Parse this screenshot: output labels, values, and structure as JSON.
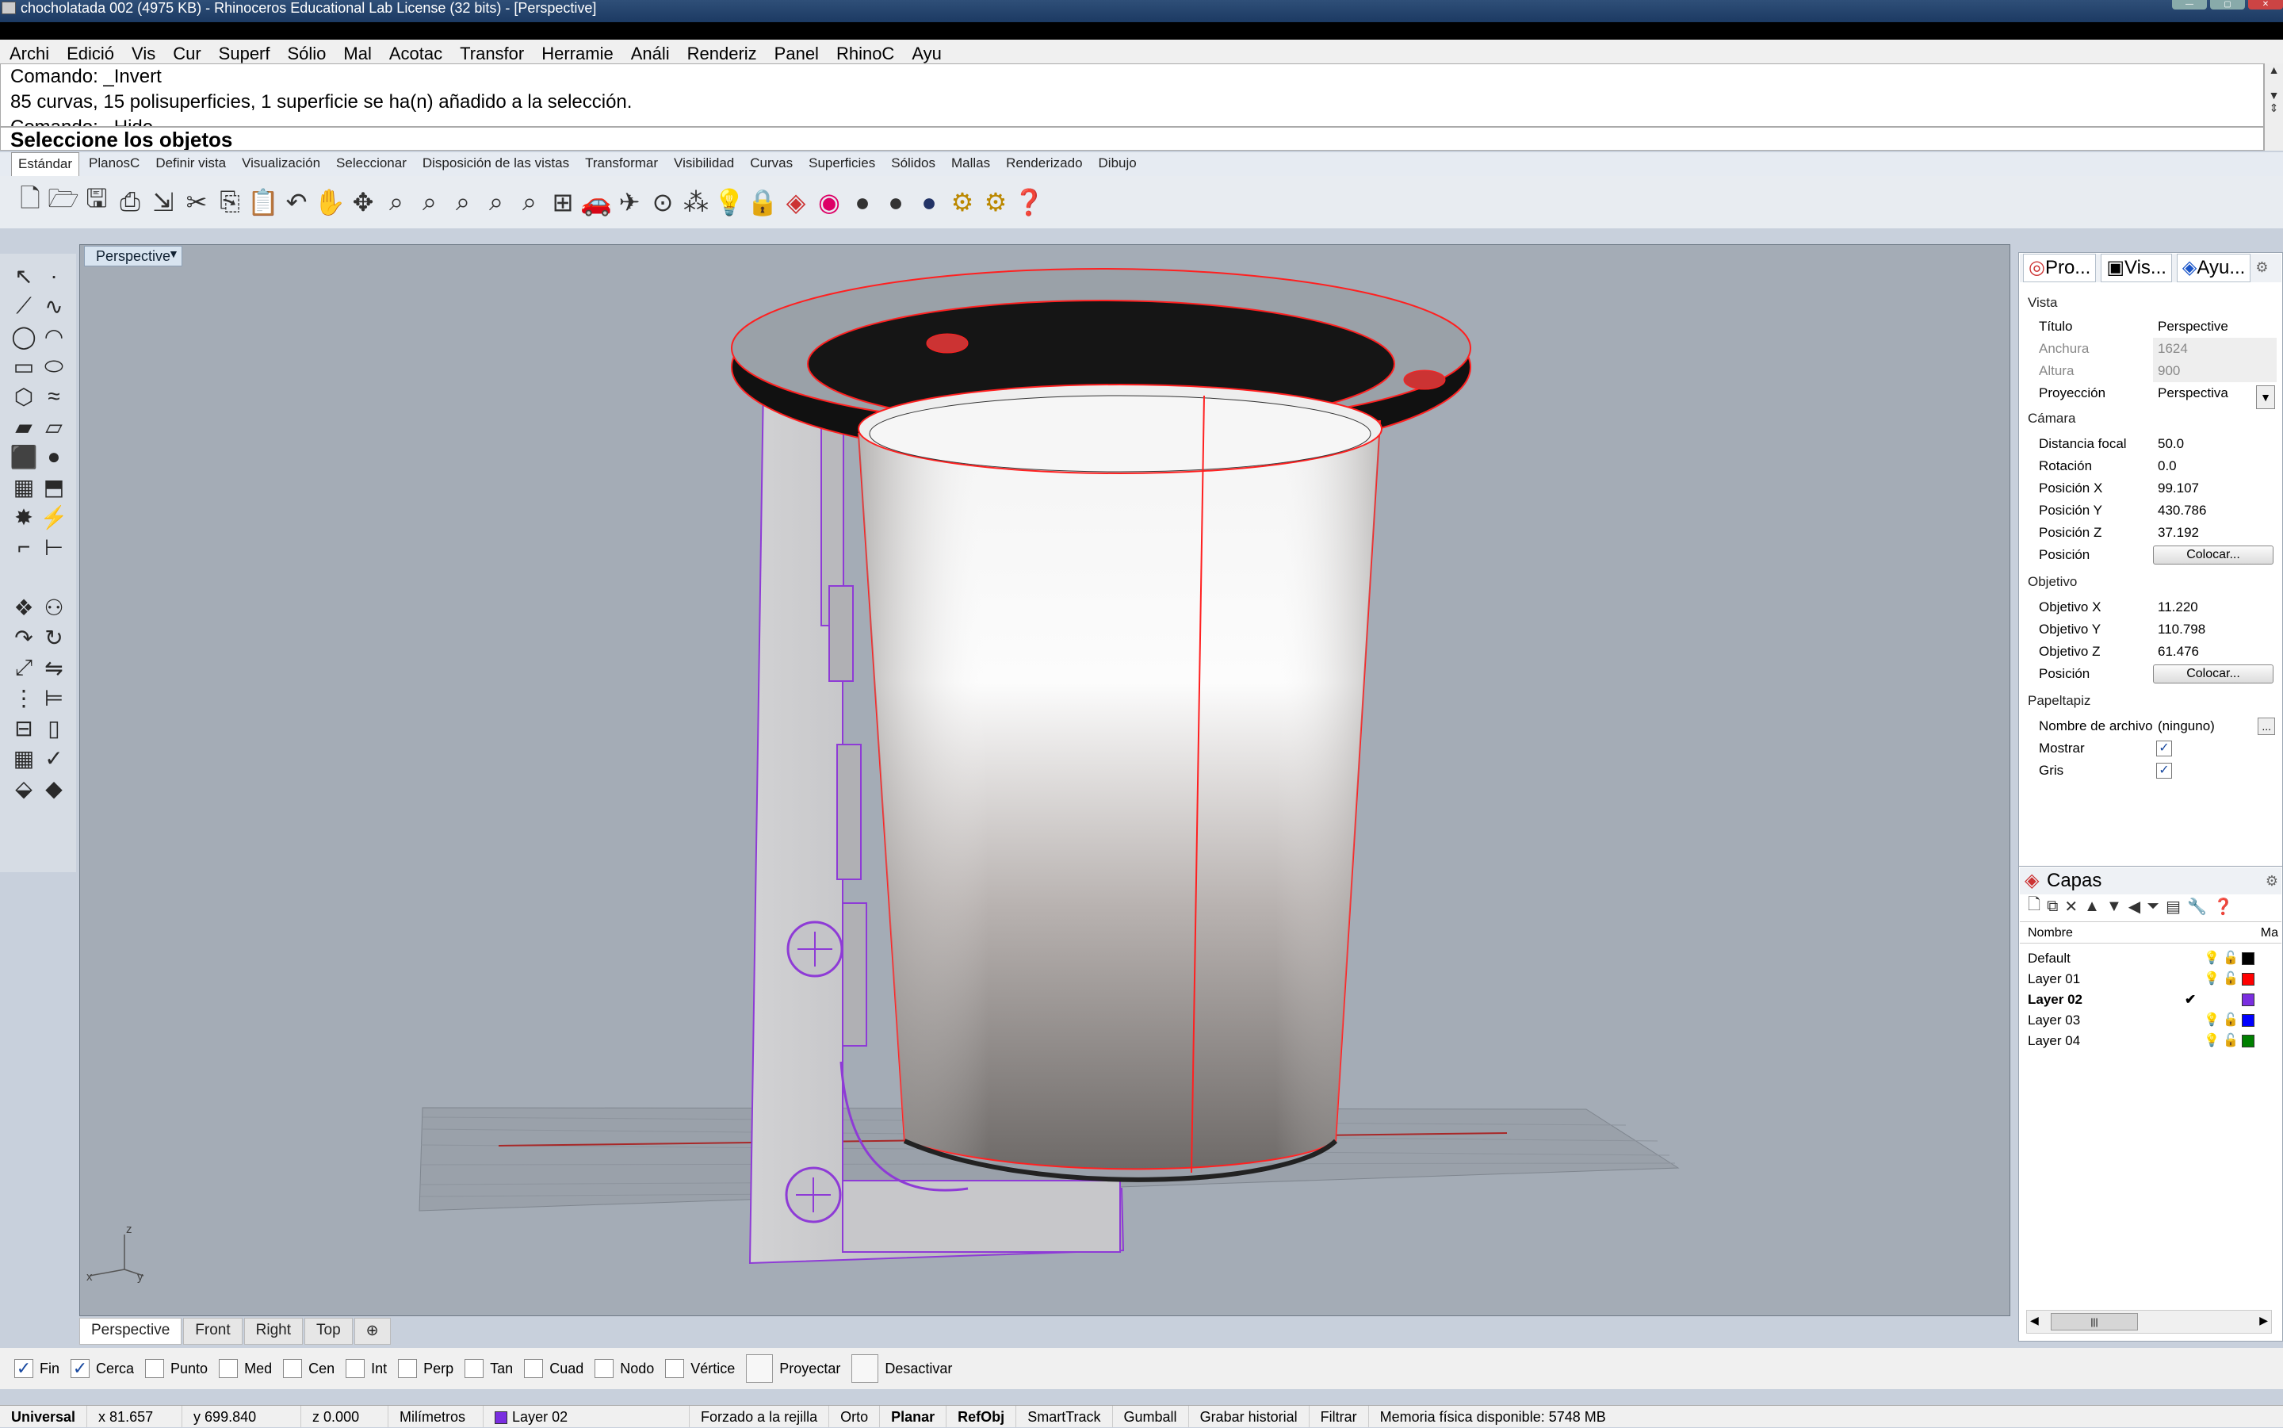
{
  "window": {
    "title": "chocholatada 002 (4975 KB) - Rhinoceros Educational Lab License (32 bits) - [Perspective]"
  },
  "menu": [
    "Archi",
    "Edició",
    "Vis",
    "Cur",
    "Superf",
    "Sólio",
    "Mal",
    "Acotac",
    "Transfor",
    "Herramie",
    "Análi",
    "Renderiz",
    "Panel",
    "RhinoC",
    "Ayu"
  ],
  "command": {
    "history_1": "Comando: _Invert",
    "history_2": "85 curvas, 15 polisuperficies, 1 superficie se ha(n) añadido a la selección.",
    "history_3": "Comando: _Hide",
    "prompt": "Seleccione los objetos"
  },
  "toolbar_tabs": [
    "Estándar",
    "PlanosC",
    "Definir vista",
    "Visualización",
    "Seleccionar",
    "Disposición de las vistas",
    "Transformar",
    "Visibilidad",
    "Curvas",
    "Superficies",
    "Sólidos",
    "Mallas",
    "Renderizado",
    "Dibujo"
  ],
  "viewport": {
    "title": "Perspective",
    "axis_z": "z",
    "axis_x": "x",
    "axis_y": "y"
  },
  "view_tabs": [
    "Perspective",
    "Front",
    "Right",
    "Top"
  ],
  "panel_tabs": [
    "Pro...",
    "Vis...",
    "Ayu..."
  ],
  "properties": {
    "vista_section": "Vista",
    "titulo_label": "Título",
    "titulo_value": "Perspective",
    "anchura_label": "Anchura",
    "anchura_value": "1624",
    "altura_label": "Altura",
    "altura_value": "900",
    "proyeccion_label": "Proyección",
    "proyeccion_value": "Perspectiva",
    "camara_section": "Cámara",
    "focal_label": "Distancia focal",
    "focal_value": "50.0",
    "rotacion_label": "Rotación",
    "rotacion_value": "0.0",
    "posx_label": "Posición X",
    "posx_value": "99.107",
    "posy_label": "Posición Y",
    "posy_value": "430.786",
    "posz_label": "Posición Z",
    "posz_value": "37.192",
    "posicion_label": "Posición",
    "colocar_label": "Colocar...",
    "objetivo_section": "Objetivo",
    "objx_label": "Objetivo X",
    "objx_value": "11.220",
    "objy_label": "Objetivo Y",
    "objy_value": "110.798",
    "objz_label": "Objetivo Z",
    "objz_value": "61.476",
    "posicion2_label": "Posición",
    "colocar2_label": "Colocar...",
    "papel_section": "Papeltapiz",
    "archivo_label": "Nombre de archivo",
    "archivo_value": "(ninguno)",
    "archivo_btn": "...",
    "mostrar_label": "Mostrar",
    "gris_label": "Gris"
  },
  "layers": {
    "title": "Capas",
    "col_name": "Nombre",
    "col_material": "Ma",
    "items": [
      {
        "name": "Default",
        "color": "#000000",
        "current": false
      },
      {
        "name": "Layer 01",
        "color": "#ff0000",
        "current": false
      },
      {
        "name": "Layer 02",
        "color": "#7a2ee0",
        "current": true
      },
      {
        "name": "Layer 03",
        "color": "#0000ff",
        "current": false
      },
      {
        "name": "Layer 04",
        "color": "#008000",
        "current": false
      }
    ],
    "current_mark": "✔"
  },
  "osnaps": [
    {
      "label": "Fin",
      "checked": true
    },
    {
      "label": "Cerca",
      "checked": true
    },
    {
      "label": "Punto",
      "checked": false
    },
    {
      "label": "Med",
      "checked": false
    },
    {
      "label": "Cen",
      "checked": false
    },
    {
      "label": "Int",
      "checked": false
    },
    {
      "label": "Perp",
      "checked": false
    },
    {
      "label": "Tan",
      "checked": false
    },
    {
      "label": "Cuad",
      "checked": false
    },
    {
      "label": "Nodo",
      "checked": false
    },
    {
      "label": "Vértice",
      "checked": false
    }
  ],
  "osnap_buttons": [
    "Proyectar",
    "Desactivar"
  ],
  "status": {
    "cplane": "Universal",
    "x": "x 81.657",
    "y": "y 699.840",
    "z": "z 0.000",
    "units": "Milímetros",
    "layer": "Layer 02",
    "layer_color": "#7a2ee0",
    "grid_snap": "Forzado a la rejilla",
    "ortho": "Orto",
    "planar": "Planar",
    "osnap": "RefObj",
    "smarttrack": "SmartTrack",
    "gumball": "Gumball",
    "history": "Grabar historial",
    "filter": "Filtrar",
    "memory": "Memoria física disponible: 5748 MB"
  },
  "colors": {
    "selection": "#ff2020",
    "layer02": "#7a2ee0",
    "viewport_bg": "#a4acb6",
    "accent": "#1c3a63"
  }
}
